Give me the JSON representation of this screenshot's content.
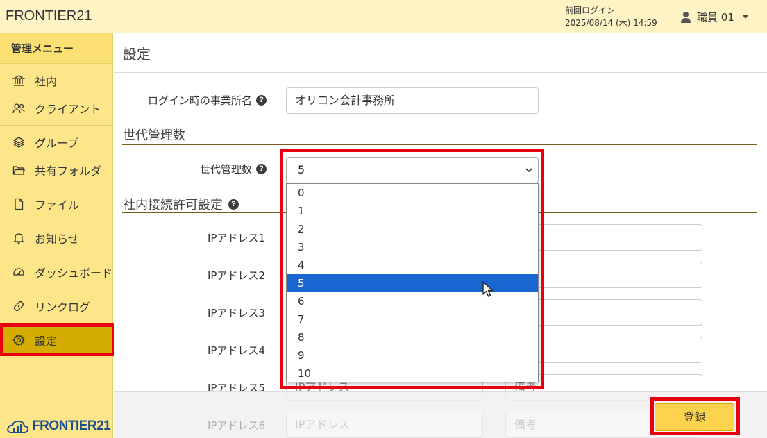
{
  "header": {
    "app_title": "FRONTIER21",
    "last_login_label": "前回ログイン",
    "last_login_time": "2025/08/14 (木) 14:59",
    "user_name": "職員 01"
  },
  "sidebar": {
    "menu_title": "管理メニュー",
    "items": [
      {
        "label": "社内",
        "icon": "building-icon"
      },
      {
        "label": "クライアント",
        "icon": "users-icon"
      },
      {
        "label": "グループ",
        "icon": "layers-icon"
      },
      {
        "label": "共有フォルダ",
        "icon": "folder-icon"
      },
      {
        "label": "ファイル",
        "icon": "file-icon"
      },
      {
        "label": "お知らせ",
        "icon": "bell-icon"
      },
      {
        "label": "ダッシュボード",
        "icon": "dashboard-icon"
      },
      {
        "label": "リンクログ",
        "icon": "link-icon"
      },
      {
        "label": "設定",
        "icon": "gear-icon",
        "active": true
      }
    ],
    "logo_text": "FRONTIER21"
  },
  "main": {
    "page_title": "設定",
    "office_name_label": "ログイン時の事業所名",
    "office_name_value": "オリコン会計事務所",
    "generation_section_title": "世代管理数",
    "generation_label": "世代管理数",
    "generation_selected": "5",
    "generation_options": [
      "0",
      "1",
      "2",
      "3",
      "4",
      "5",
      "6",
      "7",
      "8",
      "9",
      "10"
    ],
    "ip_section_title": "社内接続許可設定",
    "ip_labels": [
      "IPアドレス1",
      "IPアドレス2",
      "IPアドレス3",
      "IPアドレス4",
      "IPアドレス5",
      "IPアドレス6"
    ],
    "ip_placeholder": "IPアドレス",
    "note_placeholder": "備考",
    "save_button": "登録"
  },
  "colors": {
    "header_bg": "#fdf3c4",
    "sidebar_bg": "#fde68a",
    "active_item_bg": "#d4ad00",
    "highlight": "#e8000e",
    "selected_option": "#1a66d1",
    "save_button": "#fcd34d",
    "section_rule": "#7a5a1e"
  }
}
